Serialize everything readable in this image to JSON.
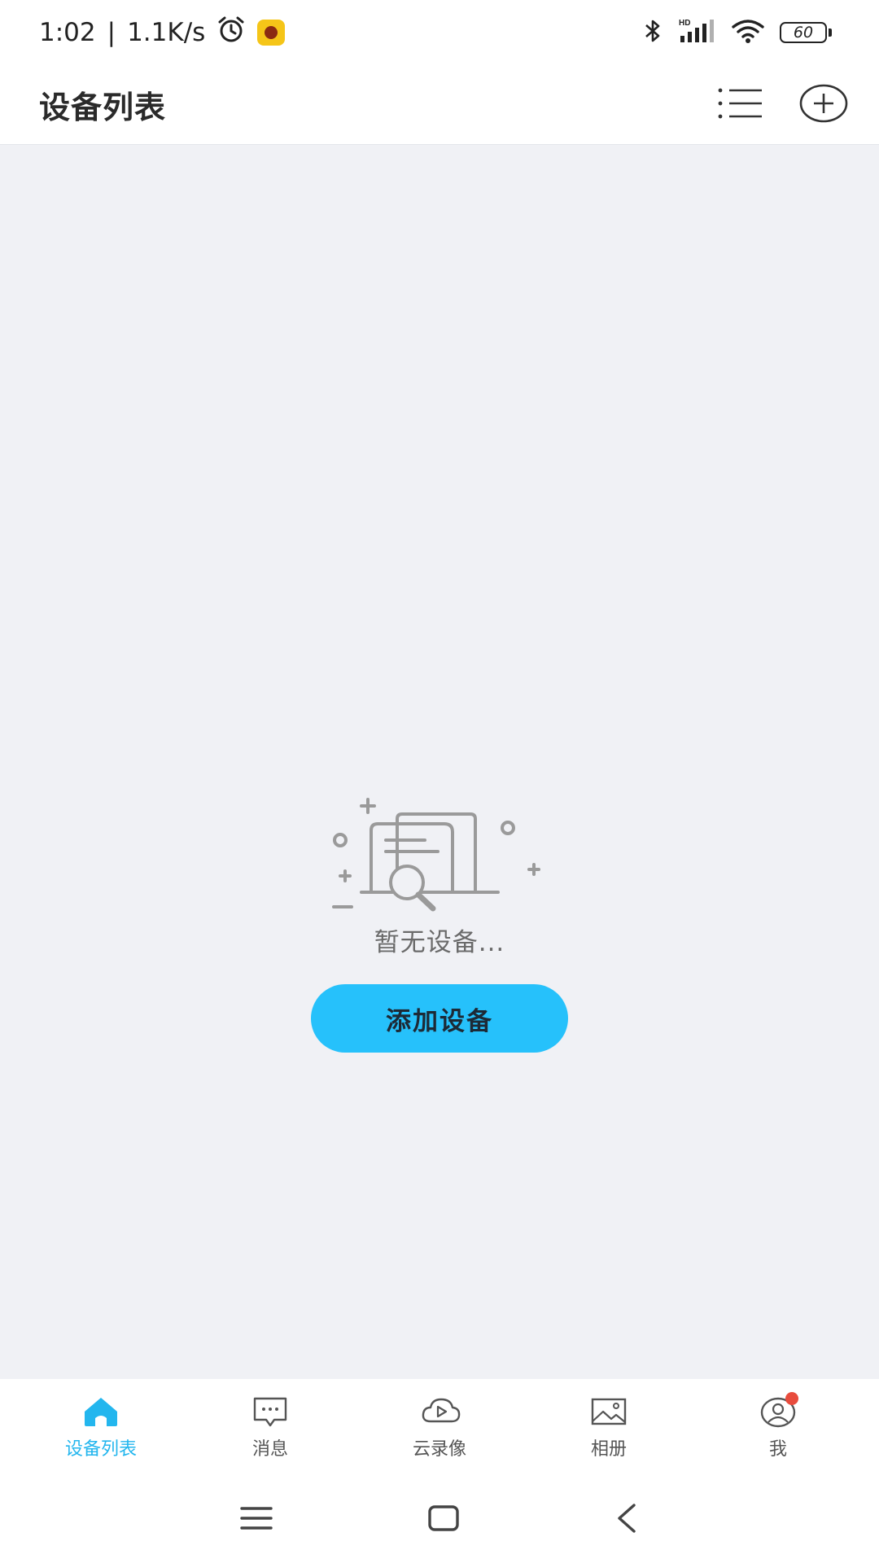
{
  "status_bar": {
    "time": "1:02",
    "separator": "|",
    "network_speed": "1.1K/s",
    "battery": "60",
    "icons": [
      "alarm-icon",
      "app-icon",
      "bluetooth-icon",
      "signal-icon",
      "wifi-icon",
      "battery-icon"
    ]
  },
  "header": {
    "title": "设备列表",
    "actions": [
      "list-icon",
      "add-icon"
    ]
  },
  "empty_state": {
    "message": "暂无设备...",
    "button_label": "添加设备",
    "illustration": "document-search-icon"
  },
  "tabs": [
    {
      "label": "设备列表",
      "icon": "home-icon",
      "active": true
    },
    {
      "label": "消息",
      "icon": "message-icon",
      "active": false
    },
    {
      "label": "云录像",
      "icon": "cloud-play-icon",
      "active": false
    },
    {
      "label": "相册",
      "icon": "album-icon",
      "active": false
    },
    {
      "label": "我",
      "icon": "profile-icon",
      "active": false,
      "badge": true
    }
  ],
  "colors": {
    "accent": "#26c1fb",
    "active_tab": "#23b6ee",
    "background": "#f0f1f5",
    "badge": "#e84c3d"
  }
}
